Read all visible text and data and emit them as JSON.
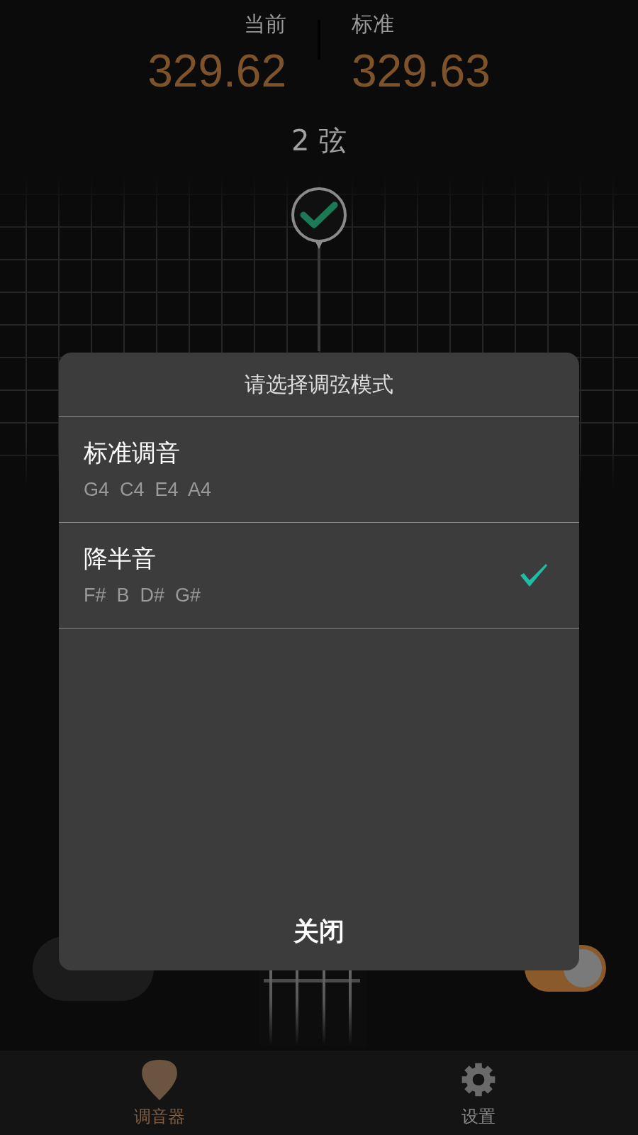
{
  "readout": {
    "current_label": "当前",
    "current_value": "329.62",
    "standard_label": "标准",
    "standard_value": "329.63"
  },
  "string_label": "2 弦",
  "auto": {
    "on": true
  },
  "dialog": {
    "title": "请选择调弦模式",
    "options": [
      {
        "name": "标准调音",
        "notes": "G4  C4  E4  A4",
        "selected": false
      },
      {
        "name": "降半音",
        "notes": "F#  B  D#  G#",
        "selected": true
      }
    ],
    "close": "关闭"
  },
  "tabs": [
    {
      "label": "调音器",
      "kind": "pick",
      "selected": true
    },
    {
      "label": "设置",
      "kind": "gear",
      "selected": false
    }
  ]
}
